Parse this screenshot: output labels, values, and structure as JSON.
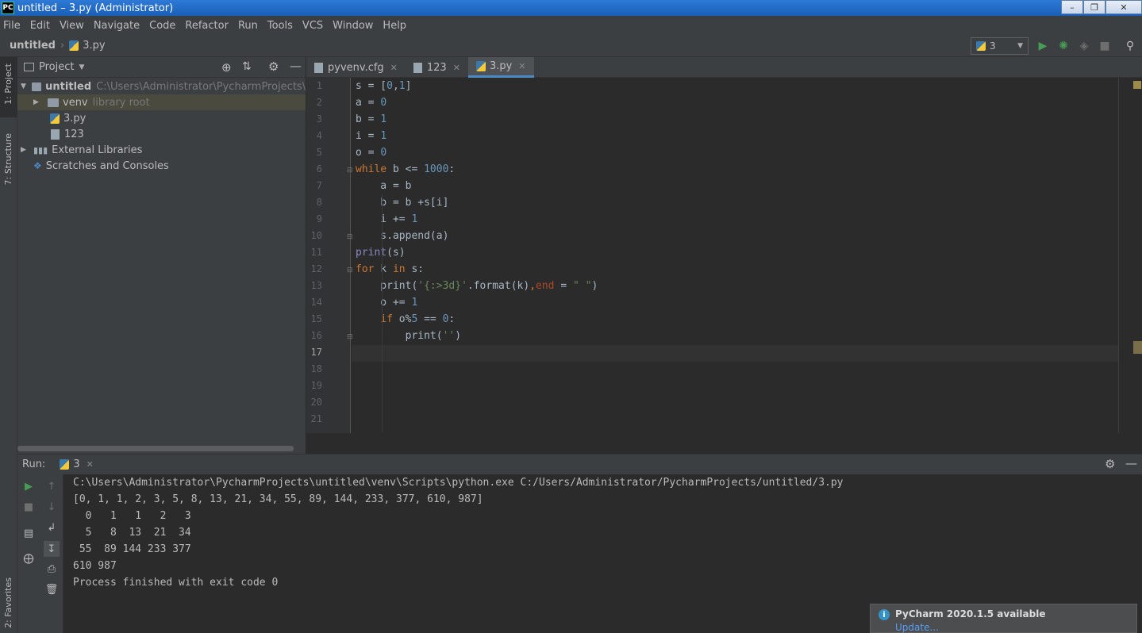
{
  "window": {
    "title": "untitled – 3.py (Administrator)",
    "logo": "PC"
  },
  "menu": [
    "File",
    "Edit",
    "View",
    "Navigate",
    "Code",
    "Refactor",
    "Run",
    "Tools",
    "VCS",
    "Window",
    "Help"
  ],
  "breadcrumb": {
    "project": "untitled",
    "file": "3.py"
  },
  "toolbar": {
    "run_config": "3"
  },
  "sidebar": {
    "project_tab": "1: Project",
    "structure_tab": "7: Structure",
    "favorites_tab": "2: Favorites"
  },
  "project_panel": {
    "title": "Project",
    "tree": {
      "root_name": "untitled",
      "root_path": "C:\\Users\\Administrator\\PycharmProjects\\untitled",
      "venv": "venv",
      "venv_note": "library root",
      "file_py": "3.py",
      "file_txt": "123",
      "external": "External Libraries",
      "scratches": "Scratches and Consoles"
    }
  },
  "editor": {
    "tabs": [
      "pyvenv.cfg",
      "123",
      "3.py"
    ],
    "active_tab": "3.py",
    "line_numbers": [
      "1",
      "2",
      "3",
      "4",
      "5",
      "6",
      "7",
      "8",
      "9",
      "10",
      "11",
      "12",
      "13",
      "14",
      "15",
      "16",
      "17",
      "18",
      "19",
      "20",
      "21"
    ],
    "code": {
      "l1a": "s = [",
      "l1b": "0",
      "l1c": ",",
      "l1d": "1",
      "l1e": "]",
      "l2a": "a = ",
      "l2b": "0",
      "l3a": "b = ",
      "l3b": "1",
      "l4a": "i = ",
      "l4b": "1",
      "l5a": "o = ",
      "l5b": "0",
      "l6a": "while",
      "l6b": " b <= ",
      "l6c": "1000",
      "l6d": ":",
      "l7": "    a = b",
      "l8": "    b = b +s[i]",
      "l9a": "    i += ",
      "l9b": "1",
      "l10": "    s.append(a)",
      "l11a": "print",
      "l11b": "(s)",
      "l12a": "for",
      "l12b": " k ",
      "l12c": "in",
      "l12d": " s:",
      "l13a": "    print(",
      "l13b": "'{:>3d}'",
      "l13c": ".format(k)",
      "l13d": ",",
      "l13e": "end",
      "l13f": " = ",
      "l13g": "\" \"",
      "l13h": ")",
      "l14a": "    o += ",
      "l14b": "1",
      "l15a": "    ",
      "l15b": "if",
      "l15c": " o%",
      "l15d": "5",
      "l15e": " == ",
      "l15f": "0",
      "l15g": ":",
      "l16a": "        print(",
      "l16b": "''",
      "l16c": ")"
    }
  },
  "run_panel": {
    "label": "Run:",
    "tab": "3",
    "output": [
      "C:\\Users\\Administrator\\PycharmProjects\\untitled\\venv\\Scripts\\python.exe C:/Users/Administrator/PycharmProjects/untitled/3.py",
      "[0, 1, 1, 2, 3, 5, 8, 13, 21, 34, 55, 89, 144, 233, 377, 610, 987]",
      "  0   1   1   2   3",
      "  5   8  13  21  34",
      " 55  89 144 233 377",
      "610 987",
      "Process finished with exit code 0"
    ]
  },
  "notification": {
    "title": "PyCharm 2020.1.5 available",
    "link": "Update..."
  },
  "colors": {
    "accent": "#4a88c7",
    "run_green": "#499c54",
    "keyword": "#cc7832",
    "number": "#6897bb",
    "string": "#6a8759"
  }
}
